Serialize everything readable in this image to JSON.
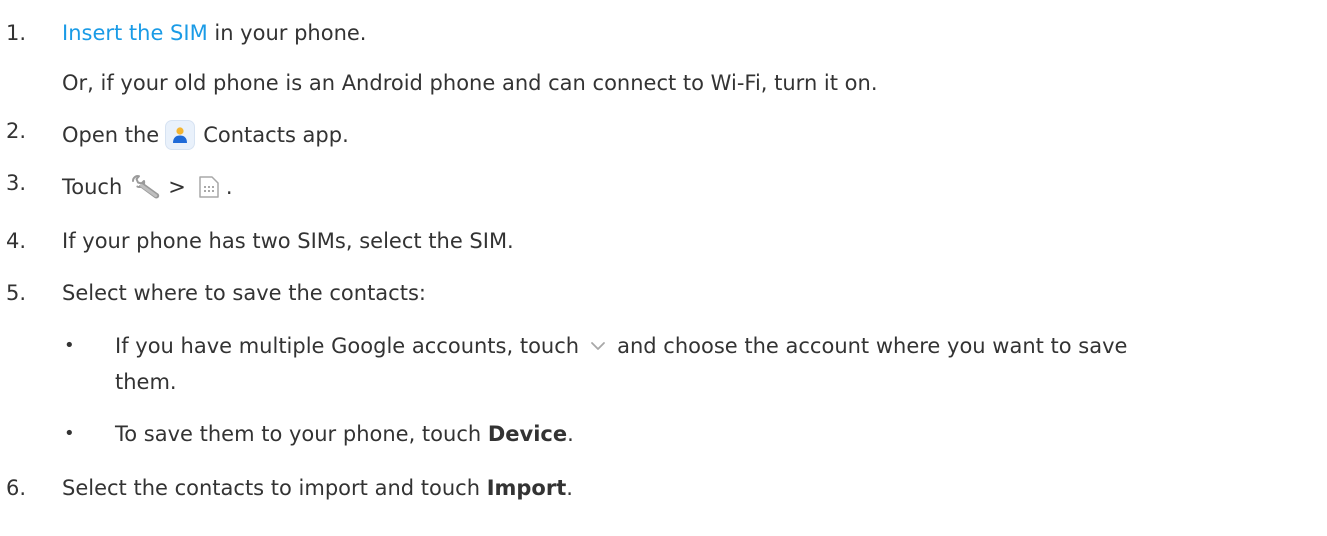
{
  "steps": [
    {
      "number": "1.",
      "link_text": "Insert the SIM",
      "text_after": " in your phone."
    },
    {
      "number": "",
      "text": "Or, if your old phone is an Android phone and can connect to Wi-Fi, turn it on."
    },
    {
      "number": "2.",
      "text_before": "Open the",
      "text_after": "Contacts app."
    },
    {
      "number": "3.",
      "text_before": "Touch",
      "separator": ">",
      "text_after": "."
    },
    {
      "number": "4.",
      "text": "If your phone has two SIMs, select the SIM."
    },
    {
      "number": "5.",
      "text": "Select where to save the contacts:"
    },
    {
      "number": "6.",
      "text_before": "Select the contacts to import and touch ",
      "bold": "Import",
      "text_after": "."
    }
  ],
  "bullets": [
    {
      "symbol": "•",
      "text_before": "If you have multiple Google accounts, touch",
      "text_after": "and choose the account where you want to save",
      "continuation": "them."
    },
    {
      "symbol": "•",
      "text_before": "To save them to your phone, touch ",
      "bold": "Device",
      "text_after": "."
    }
  ],
  "icons": {
    "contacts": "contacts-app-icon",
    "wrench": "wrench-icon",
    "sim": "sim-card-icon",
    "chevron": "chevron-down-icon"
  },
  "colors": {
    "link": "#1a9be6",
    "text": "#333333",
    "contacts_icon_figure": "#1f6ad8",
    "contacts_icon_accent": "#f3b533"
  }
}
